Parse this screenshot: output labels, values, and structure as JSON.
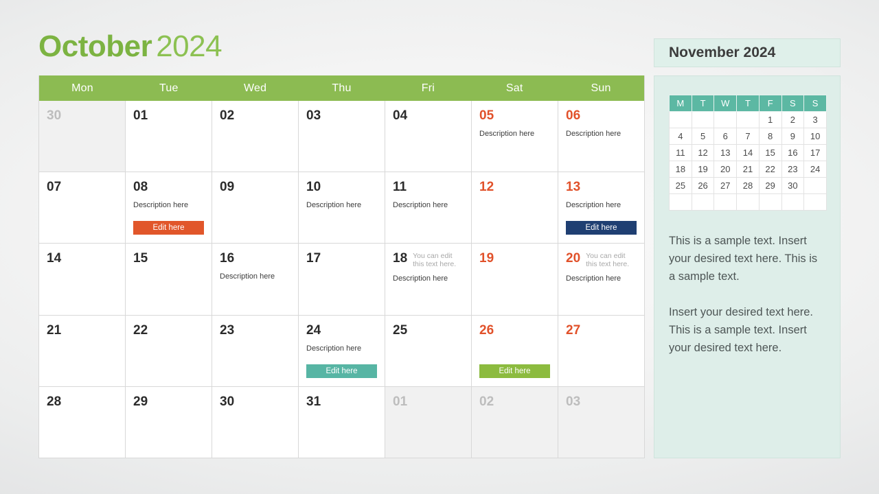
{
  "title": {
    "month": "October",
    "year": "2024"
  },
  "calendar": {
    "weekdays": [
      "Mon",
      "Tue",
      "Wed",
      "Thu",
      "Fri",
      "Sat",
      "Sun"
    ],
    "weeks": [
      [
        {
          "num": "30",
          "muted": true,
          "weekend": false,
          "desc": "",
          "note": "",
          "button": null
        },
        {
          "num": "01",
          "muted": false,
          "weekend": false,
          "desc": "",
          "note": "",
          "button": null
        },
        {
          "num": "02",
          "muted": false,
          "weekend": false,
          "desc": "",
          "note": "",
          "button": null
        },
        {
          "num": "03",
          "muted": false,
          "weekend": false,
          "desc": "",
          "note": "",
          "button": null
        },
        {
          "num": "04",
          "muted": false,
          "weekend": false,
          "desc": "",
          "note": "",
          "button": null
        },
        {
          "num": "05",
          "muted": false,
          "weekend": true,
          "desc": "Description here",
          "note": "",
          "button": null
        },
        {
          "num": "06",
          "muted": false,
          "weekend": true,
          "desc": "Description here",
          "note": "",
          "button": null
        }
      ],
      [
        {
          "num": "07",
          "muted": false,
          "weekend": false,
          "desc": "",
          "note": "",
          "button": null
        },
        {
          "num": "08",
          "muted": false,
          "weekend": false,
          "desc": "Description here",
          "note": "",
          "button": {
            "label": "Edit here",
            "color": "#e1562a"
          }
        },
        {
          "num": "09",
          "muted": false,
          "weekend": false,
          "desc": "",
          "note": "",
          "button": null
        },
        {
          "num": "10",
          "muted": false,
          "weekend": false,
          "desc": "Description here",
          "note": "",
          "button": null
        },
        {
          "num": "11",
          "muted": false,
          "weekend": false,
          "desc": "Description here",
          "note": "",
          "button": null
        },
        {
          "num": "12",
          "muted": false,
          "weekend": true,
          "desc": "",
          "note": "",
          "button": null
        },
        {
          "num": "13",
          "muted": false,
          "weekend": true,
          "desc": "Description here",
          "note": "",
          "button": {
            "label": "Edit here",
            "color": "#1f3f72"
          }
        }
      ],
      [
        {
          "num": "14",
          "muted": false,
          "weekend": false,
          "desc": "",
          "note": "",
          "button": null
        },
        {
          "num": "15",
          "muted": false,
          "weekend": false,
          "desc": "",
          "note": "",
          "button": null
        },
        {
          "num": "16",
          "muted": false,
          "weekend": false,
          "desc": "Description here",
          "note": "",
          "button": null
        },
        {
          "num": "17",
          "muted": false,
          "weekend": false,
          "desc": "",
          "note": "",
          "button": null
        },
        {
          "num": "18",
          "muted": false,
          "weekend": false,
          "desc": "Description here",
          "note": "You can edit this text here.",
          "button": null
        },
        {
          "num": "19",
          "muted": false,
          "weekend": true,
          "desc": "",
          "note": "",
          "button": null
        },
        {
          "num": "20",
          "muted": false,
          "weekend": true,
          "desc": "Description here",
          "note": "You can edit this text here.",
          "button": null
        }
      ],
      [
        {
          "num": "21",
          "muted": false,
          "weekend": false,
          "desc": "",
          "note": "",
          "button": null
        },
        {
          "num": "22",
          "muted": false,
          "weekend": false,
          "desc": "",
          "note": "",
          "button": null
        },
        {
          "num": "23",
          "muted": false,
          "weekend": false,
          "desc": "",
          "note": "",
          "button": null
        },
        {
          "num": "24",
          "muted": false,
          "weekend": false,
          "desc": "Description here",
          "note": "",
          "button": {
            "label": "Edit here",
            "color": "#57b5a4"
          }
        },
        {
          "num": "25",
          "muted": false,
          "weekend": false,
          "desc": "",
          "note": "",
          "button": null
        },
        {
          "num": "26",
          "muted": false,
          "weekend": true,
          "desc": "",
          "note": "",
          "button": {
            "label": "Edit here",
            "color": "#8cbb3f"
          }
        },
        {
          "num": "27",
          "muted": false,
          "weekend": true,
          "desc": "",
          "note": "",
          "button": null
        }
      ],
      [
        {
          "num": "28",
          "muted": false,
          "weekend": false,
          "desc": "",
          "note": "",
          "button": null
        },
        {
          "num": "29",
          "muted": false,
          "weekend": false,
          "desc": "",
          "note": "",
          "button": null
        },
        {
          "num": "30",
          "muted": false,
          "weekend": false,
          "desc": "",
          "note": "",
          "button": null
        },
        {
          "num": "31",
          "muted": false,
          "weekend": false,
          "desc": "",
          "note": "",
          "button": null
        },
        {
          "num": "01",
          "muted": true,
          "weekend": false,
          "desc": "",
          "note": "",
          "button": null
        },
        {
          "num": "02",
          "muted": true,
          "weekend": false,
          "desc": "",
          "note": "",
          "button": null
        },
        {
          "num": "03",
          "muted": true,
          "weekend": false,
          "desc": "",
          "note": "",
          "button": null
        }
      ]
    ]
  },
  "sidebar": {
    "header_title": "November 2024",
    "mini_calendar": {
      "weekdays": [
        "M",
        "T",
        "W",
        "T",
        "F",
        "S",
        "S"
      ],
      "weeks": [
        [
          "",
          "",
          "",
          "",
          "1",
          "2",
          "3"
        ],
        [
          "4",
          "5",
          "6",
          "7",
          "8",
          "9",
          "10"
        ],
        [
          "11",
          "12",
          "13",
          "14",
          "15",
          "16",
          "17"
        ],
        [
          "18",
          "19",
          "20",
          "21",
          "22",
          "23",
          "24"
        ],
        [
          "25",
          "26",
          "27",
          "28",
          "29",
          "30",
          ""
        ],
        [
          "",
          "",
          "",
          "",
          "",
          "",
          ""
        ]
      ]
    },
    "paragraphs": [
      "This is a sample text. Insert your desired text here. This is a sample text.",
      "Insert your desired text here. This is a sample text. Insert your desired text here."
    ]
  },
  "colors": {
    "header_green": "#8cbb52",
    "title_green": "#7cb342",
    "weekend_orange": "#e1512a",
    "sidebar_mint": "#deeee9",
    "mini_header_teal": "#5cb8a3"
  }
}
